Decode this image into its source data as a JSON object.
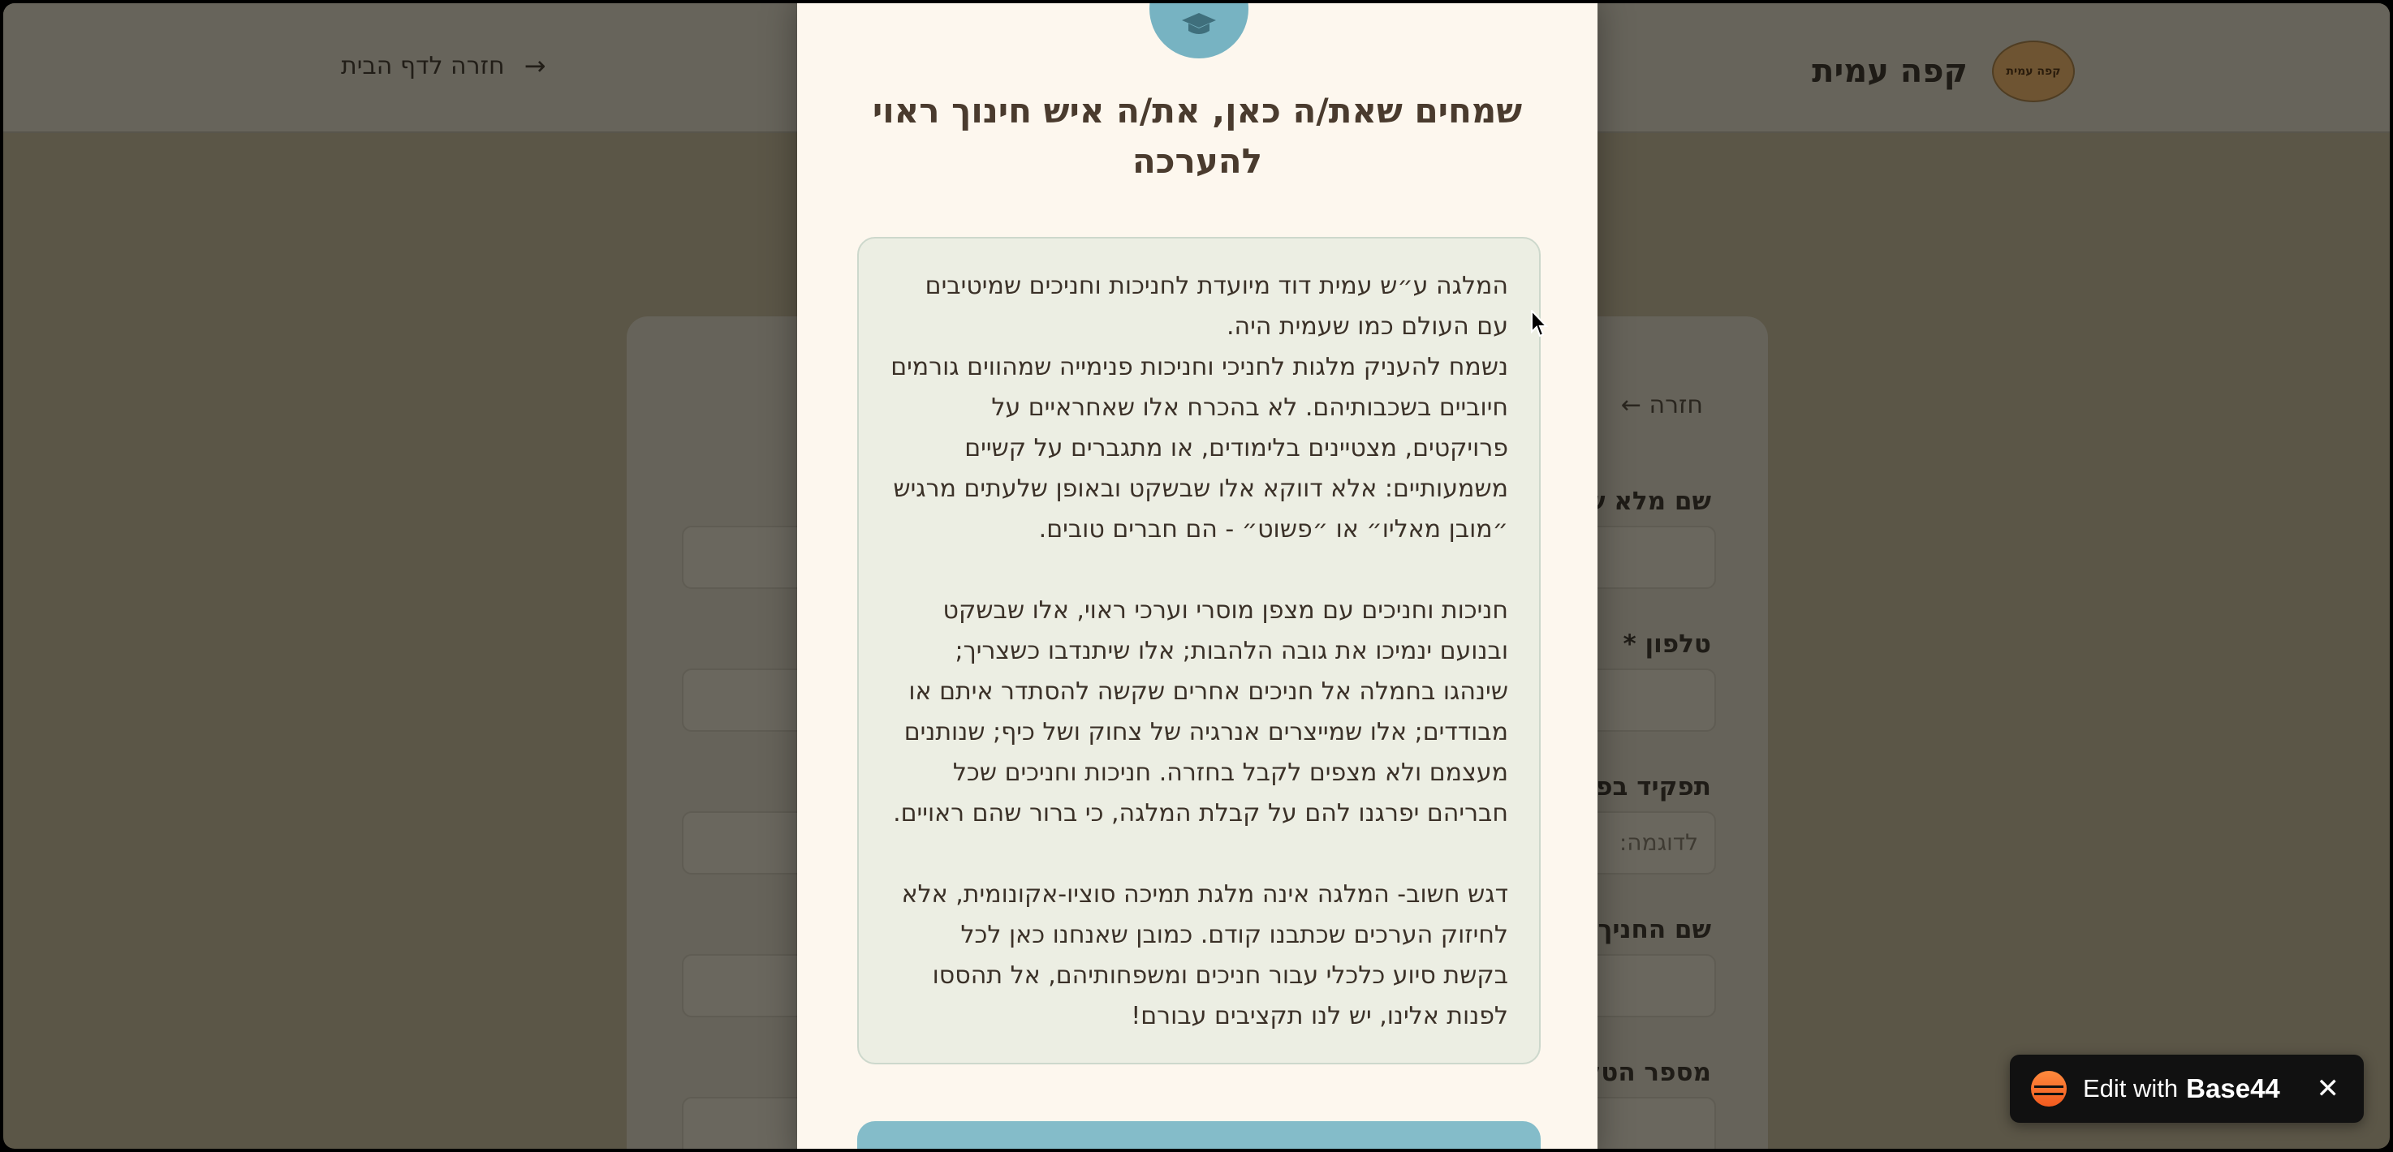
{
  "header": {
    "brand_name": "קפה עמית",
    "logo_text": "קפה עמית",
    "back_home_label": "חזרה לדף הבית"
  },
  "background_form": {
    "back_label": "חזרה ←",
    "labels": [
      "שם מלא ש",
      "טלפון *",
      "תפקיד בפ",
      "שם החניך",
      "מספר הטל"
    ],
    "role_placeholder": "לדוגמה:"
  },
  "modal": {
    "title": "שמחים שאת/ה כאן, את/ה איש חינוך ראוי להערכה",
    "paragraphs": [
      "המלגה ע״ש עמית דוד מיועדת לחניכות וחניכים שמיטיבים עם העולם כמו שעמית היה.\nנשמח להעניק מלגות לחניכי וחניכות פנימייה שמהווים גורמים חיוביים בשכבותיהם. לא בהכרח אלו שאחראיים על פרויקטים, מצטיינים בלימודים, או מתגברים על קשיים משמעותיים: אלא דווקא אלו שבשקט ובאופן שלעתים מרגיש ״מובן מאליו״ או ״פשוט״ - הם חברים טובים.",
      "חניכות וחניכים עם מצפן מוסרי וערכי ראוי, אלו שבשקט ובנועם ינמיכו את גובה הלהבות; אלו שיתנדבו כשצריך; שינהגו בחמלה אל חניכים אחרים שקשה להסתדר איתם או מבודדים; אלו שמייצרים אנרגיה של צחוק ושל כיף; שנותנים מעצמם ולא מצפים לקבל בחזרה. חניכות וחניכים שכל חבריהם יפרגנו להם על קבלת המלגה, כי ברור שהם ראויים.",
      "דגש חשוב- המלגה אינה מלגת תמיכה סוציו-אקונומית, אלא לחיזוק הערכים שכתבנו קודם. כמובן שאנחנו כאן לכל בקשת סיוע כלכלי עבור חניכים ומשפחותיהם, אל תהססו לפנות אלינו, יש לנו תקציבים עבורם!"
    ]
  },
  "badge": {
    "text": "Edit with",
    "brand": "Base44",
    "close": "✕"
  },
  "colors": {
    "modal_bg": "#fdf7ee",
    "accent_teal": "#77b3c2",
    "title_brown": "#4a3b2e",
    "text_box_bg": "#eceee3",
    "overlay": "#5b5647",
    "badge_orange": "#f25a1f"
  },
  "icons": {
    "modal_top": "graduation-cap-icon",
    "back_home": "arrow-right-icon",
    "badge_logo": "base44-logo-icon",
    "badge_close": "close-icon"
  }
}
